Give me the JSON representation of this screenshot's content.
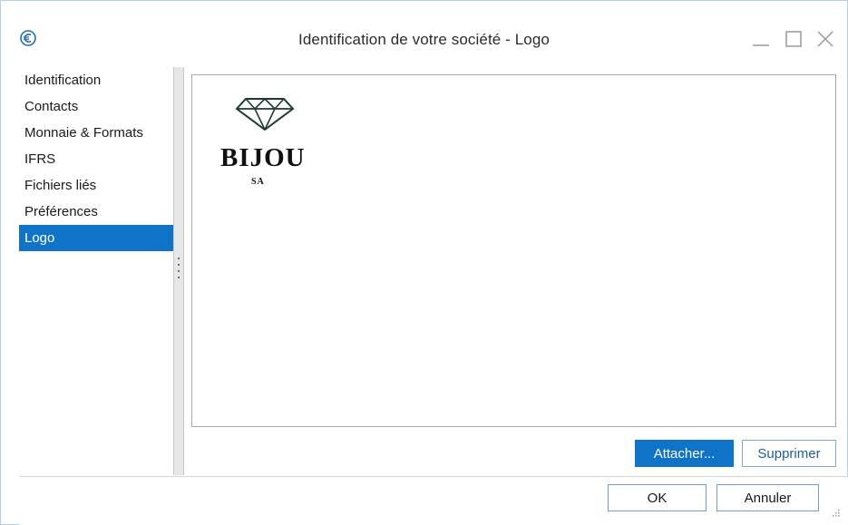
{
  "window": {
    "title": "Identification de votre société - Logo",
    "app_icon": "currency-circle-icon",
    "controls": [
      "minimize-icon",
      "maximize-icon",
      "close-icon"
    ]
  },
  "nav": {
    "items": [
      {
        "label": "Identification",
        "selected": false
      },
      {
        "label": "Contacts",
        "selected": false
      },
      {
        "label": "Monnaie & Formats",
        "selected": false
      },
      {
        "label": "IFRS",
        "selected": false
      },
      {
        "label": "Fichiers liés",
        "selected": false
      },
      {
        "label": "Préférences",
        "selected": false
      },
      {
        "label": "Logo",
        "selected": true
      }
    ]
  },
  "logo": {
    "name": "BIJOU",
    "subtitle": "SA",
    "icon": "diamond-icon"
  },
  "actions": {
    "attach_label": "Attacher...",
    "delete_label": "Supprimer"
  },
  "footer": {
    "ok_label": "OK",
    "cancel_label": "Annuler"
  },
  "colors": {
    "accent": "#0f73c8",
    "window_border": "#b9cde0"
  }
}
